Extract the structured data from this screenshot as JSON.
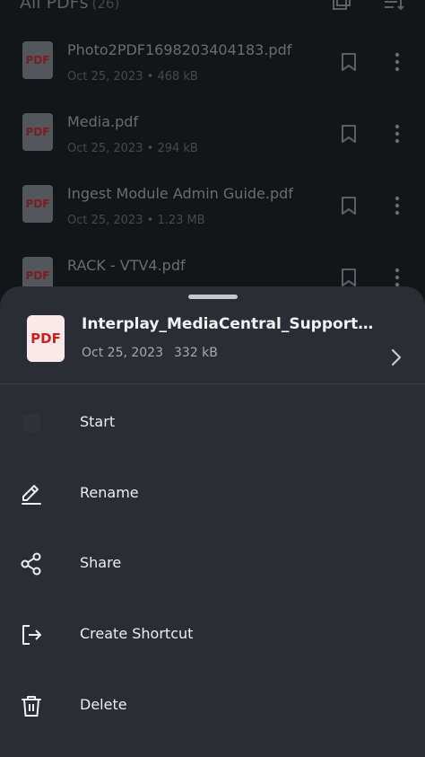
{
  "list": {
    "title": "All PDFs",
    "count": "(26)",
    "items": [
      {
        "name": "Photo2PDF1698203404183.pdf",
        "date": "Oct 25, 2023",
        "size": "468 kB",
        "thumb": "PDF"
      },
      {
        "name": "Media.pdf",
        "date": "Oct 25, 2023",
        "size": "294 kB",
        "thumb": "PDF"
      },
      {
        "name": "Ingest Module Admin Guide.pdf",
        "date": "Oct 25, 2023",
        "size": "1.23 MB",
        "thumb": "PDF"
      },
      {
        "name": "RACK - VTV4.pdf",
        "date": "",
        "size": "",
        "thumb": "PDF"
      }
    ],
    "separator": "•"
  },
  "sheet": {
    "file": {
      "thumb": "PDF",
      "name": "Interplay_MediaCentral_Support…",
      "date": "Oct 25, 2023",
      "size": "332 kB"
    },
    "actions": [
      {
        "label": "Start",
        "icon": "star-icon"
      },
      {
        "label": "Rename",
        "icon": "pencil-icon"
      },
      {
        "label": "Share",
        "icon": "share-icon"
      },
      {
        "label": "Create Shortcut",
        "icon": "shortcut-icon"
      },
      {
        "label": "Delete",
        "icon": "trash-icon"
      }
    ]
  },
  "colors": {
    "background": "#141519",
    "sheet": "#2a2d33",
    "pdf_red": "#cc1f1f"
  }
}
